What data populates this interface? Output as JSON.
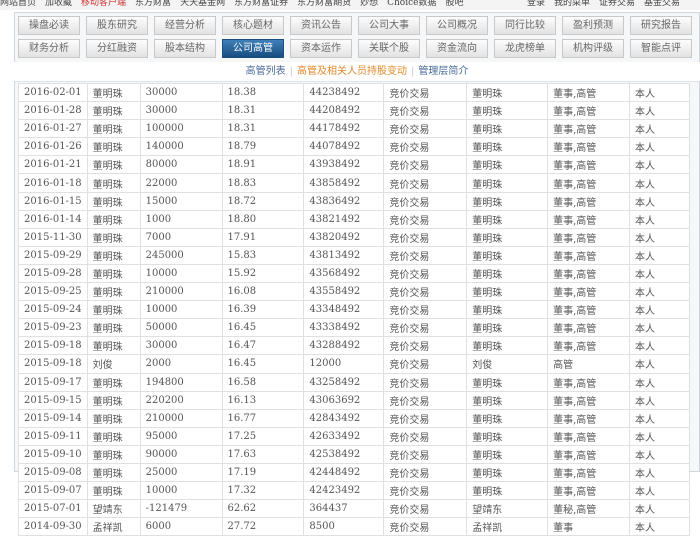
{
  "topnav": {
    "left": [
      "网站首页",
      "加收藏",
      "移动客户端",
      "东方财富",
      "天天基金网",
      "东方财富证券",
      "东方财富期货",
      "妙想",
      "Choice数据",
      "股吧"
    ],
    "right": [
      "登录",
      "我的菜单",
      "证券交易",
      "基金交易"
    ]
  },
  "tabs_row1": [
    "操盘必读",
    "股东研究",
    "经营分析",
    "核心题材",
    "资讯公告",
    "公司大事",
    "公司概况",
    "同行比较",
    "盈利预测",
    "研究报告"
  ],
  "tabs_row2": [
    "财务分析",
    "分红融资",
    "股本结构",
    "公司高管",
    "资本运作",
    "关联个股",
    "资金流向",
    "龙虎榜单",
    "机构评级",
    "智能点评"
  ],
  "active_tab": "公司高管",
  "subnav": {
    "items": [
      "高管列表",
      "高管及相关人员持股变动",
      "管理层简介"
    ],
    "active": "高管及相关人员持股变动"
  },
  "rows": [
    [
      "2016-02-01",
      "董明珠",
      "30000",
      "18.38",
      "44238492",
      "竞价交易",
      "董明珠",
      "董事,高管",
      "本人"
    ],
    [
      "2016-01-28",
      "董明珠",
      "30000",
      "18.31",
      "44208492",
      "竞价交易",
      "董明珠",
      "董事,高管",
      "本人"
    ],
    [
      "2016-01-27",
      "董明珠",
      "100000",
      "18.31",
      "44178492",
      "竞价交易",
      "董明珠",
      "董事,高管",
      "本人"
    ],
    [
      "2016-01-26",
      "董明珠",
      "140000",
      "18.79",
      "44078492",
      "竞价交易",
      "董明珠",
      "董事,高管",
      "本人"
    ],
    [
      "2016-01-21",
      "董明珠",
      "80000",
      "18.91",
      "43938492",
      "竞价交易",
      "董明珠",
      "董事,高管",
      "本人"
    ],
    [
      "2016-01-18",
      "董明珠",
      "22000",
      "18.83",
      "43858492",
      "竞价交易",
      "董明珠",
      "董事,高管",
      "本人"
    ],
    [
      "2016-01-15",
      "董明珠",
      "15000",
      "18.72",
      "43836492",
      "竞价交易",
      "董明珠",
      "董事,高管",
      "本人"
    ],
    [
      "2016-01-14",
      "董明珠",
      "1000",
      "18.80",
      "43821492",
      "竞价交易",
      "董明珠",
      "董事,高管",
      "本人"
    ],
    [
      "2015-11-30",
      "董明珠",
      "7000",
      "17.91",
      "43820492",
      "竞价交易",
      "董明珠",
      "董事,高管",
      "本人"
    ],
    [
      "2015-09-29",
      "董明珠",
      "245000",
      "15.83",
      "43813492",
      "竞价交易",
      "董明珠",
      "董事,高管",
      "本人"
    ],
    [
      "2015-09-28",
      "董明珠",
      "10000",
      "15.92",
      "43568492",
      "竞价交易",
      "董明珠",
      "董事,高管",
      "本人"
    ],
    [
      "2015-09-25",
      "董明珠",
      "210000",
      "16.08",
      "43558492",
      "竞价交易",
      "董明珠",
      "董事,高管",
      "本人"
    ],
    [
      "2015-09-24",
      "董明珠",
      "10000",
      "16.39",
      "43348492",
      "竞价交易",
      "董明珠",
      "董事,高管",
      "本人"
    ],
    [
      "2015-09-23",
      "董明珠",
      "50000",
      "16.45",
      "43338492",
      "竞价交易",
      "董明珠",
      "董事,高管",
      "本人"
    ],
    [
      "2015-09-18",
      "董明珠",
      "30000",
      "16.47",
      "43288492",
      "竞价交易",
      "董明珠",
      "董事,高管",
      "本人"
    ],
    [
      "2015-09-18",
      "刘俊",
      "2000",
      "16.45",
      "12000",
      "竞价交易",
      "刘俊",
      "高管",
      "本人"
    ],
    [
      "2015-09-17",
      "董明珠",
      "194800",
      "16.58",
      "43258492",
      "竞价交易",
      "董明珠",
      "董事,高管",
      "本人"
    ],
    [
      "2015-09-15",
      "董明珠",
      "220200",
      "16.13",
      "43063692",
      "竞价交易",
      "董明珠",
      "董事,高管",
      "本人"
    ],
    [
      "2015-09-14",
      "董明珠",
      "210000",
      "16.77",
      "42843492",
      "竞价交易",
      "董明珠",
      "董事,高管",
      "本人"
    ],
    [
      "2015-09-11",
      "董明珠",
      "95000",
      "17.25",
      "42633492",
      "竞价交易",
      "董明珠",
      "董事,高管",
      "本人"
    ],
    [
      "2015-09-10",
      "董明珠",
      "90000",
      "17.63",
      "42538492",
      "竞价交易",
      "董明珠",
      "董事,高管",
      "本人"
    ],
    [
      "2015-09-08",
      "董明珠",
      "25000",
      "17.19",
      "42448492",
      "竞价交易",
      "董明珠",
      "董事,高管",
      "本人"
    ],
    [
      "2015-09-07",
      "董明珠",
      "10000",
      "17.32",
      "42423492",
      "竞价交易",
      "董明珠",
      "董事,高管",
      "本人"
    ],
    [
      "2015-07-01",
      "望靖东",
      "-121479",
      "62.62",
      "364437",
      "竞价交易",
      "望靖东",
      "董秘,高管",
      "本人"
    ],
    [
      "2014-09-30",
      "孟祥凯",
      "6000",
      "27.72",
      "8500",
      "竞价交易",
      "孟祥凯",
      "董事",
      "本人"
    ]
  ]
}
